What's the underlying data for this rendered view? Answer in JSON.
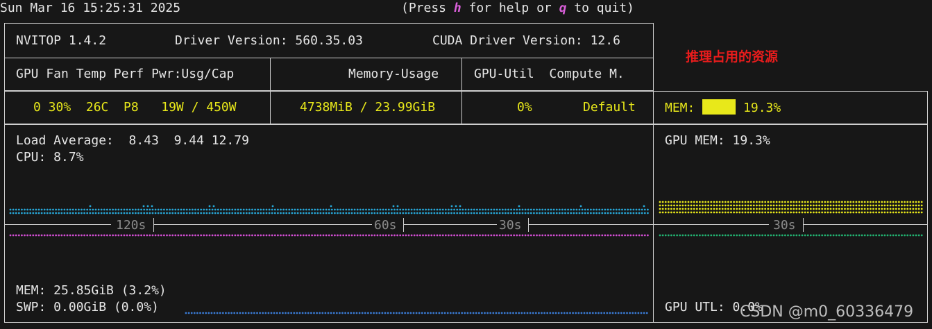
{
  "header": {
    "datetime": "Sun Mar 16 15:25:31 2025",
    "help_prefix": "(Press ",
    "help_key_h": "h",
    "help_middle": " for help or ",
    "help_key_q": "q",
    "help_suffix": " to quit)"
  },
  "info": {
    "app": "NVITOP 1.4.2",
    "driver": "Driver Version: 560.35.03",
    "cuda": "CUDA Driver Version: 12.6"
  },
  "columns": {
    "left": "GPU Fan Temp Perf Pwr:Usg/Cap",
    "mid": "Memory-Usage",
    "right": "GPU-Util  Compute M."
  },
  "gpu_row": {
    "left": "0 30%  26C  P8   19W / 450W",
    "mem": "4738MiB / 23.99GiB",
    "util": "0%",
    "compute": "Default",
    "mem_label": "MEM:",
    "mem_pct": "19.3%",
    "mem_fraction": 0.193
  },
  "annotation": "推理占用的资源",
  "host": {
    "load": "Load Average:  8.43  9.44 12.79",
    "cpu": "CPU: 8.7%",
    "mem": "MEM: 25.85GiB (3.2%)",
    "swp": "SWP: 0.00GiB (0.0%)"
  },
  "gpu_panel": {
    "mem": "GPU MEM: 19.3%",
    "utl": "GPU UTL: 0.0%"
  },
  "timeline": {
    "t120": "120s",
    "t60": "60s",
    "t30": "30s",
    "t30_right": "30s"
  },
  "colors": {
    "cpu_dots": "#27a7d8",
    "mem_dots": "#d44fd4",
    "swp_dots": "#3a7bd5",
    "gpu_mem_dots": "#e8e81a",
    "gpu_utl_dots": "#22b573"
  },
  "watermark": "CSDN @m0_60336479"
}
